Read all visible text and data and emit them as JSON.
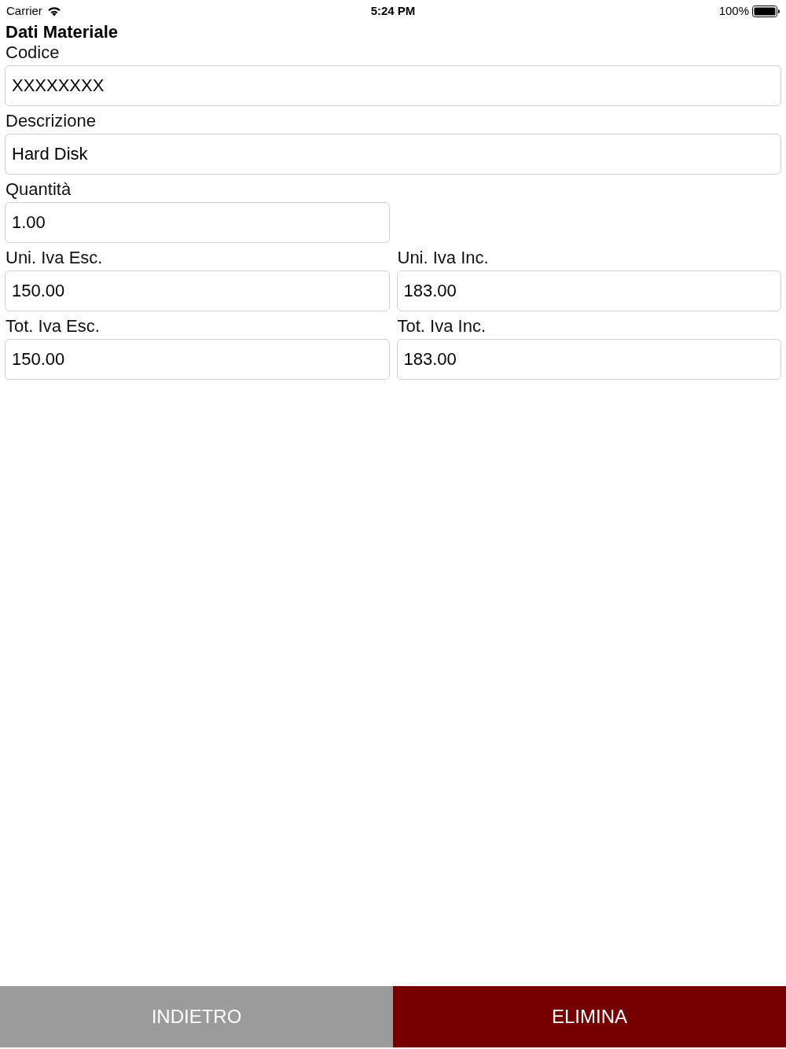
{
  "status_bar": {
    "carrier": "Carrier",
    "time": "5:24 PM",
    "battery": "100%"
  },
  "title": "Dati Materiale",
  "rows": [
    {
      "fields": [
        {
          "label": "Codice",
          "value": "XXXXXXXX",
          "kind": "wide"
        }
      ]
    },
    {
      "fields": [
        {
          "label": "Descrizione",
          "value": "Hard Disk",
          "kind": "wide"
        }
      ]
    },
    {
      "fields": [
        {
          "label": "Quantità",
          "value": "1.00",
          "kind": "narrow"
        }
      ]
    },
    {
      "fields": [
        {
          "label": "Uni. Iva Esc.",
          "value": "150.00",
          "kind": "narrow"
        },
        {
          "label": "Uni. Iva Inc.",
          "value": "183.00",
          "kind": "narrow"
        }
      ]
    },
    {
      "fields": [
        {
          "label": "Tot. Iva Esc.",
          "value": "150.00",
          "kind": "narrow"
        },
        {
          "label": "Tot. Iva Inc.",
          "value": "183.00",
          "kind": "narrow"
        }
      ]
    }
  ],
  "buttons": [
    {
      "label": "INDIETRO",
      "kind": "secondary"
    },
    {
      "label": "ELIMINA",
      "kind": "destructive"
    }
  ]
}
